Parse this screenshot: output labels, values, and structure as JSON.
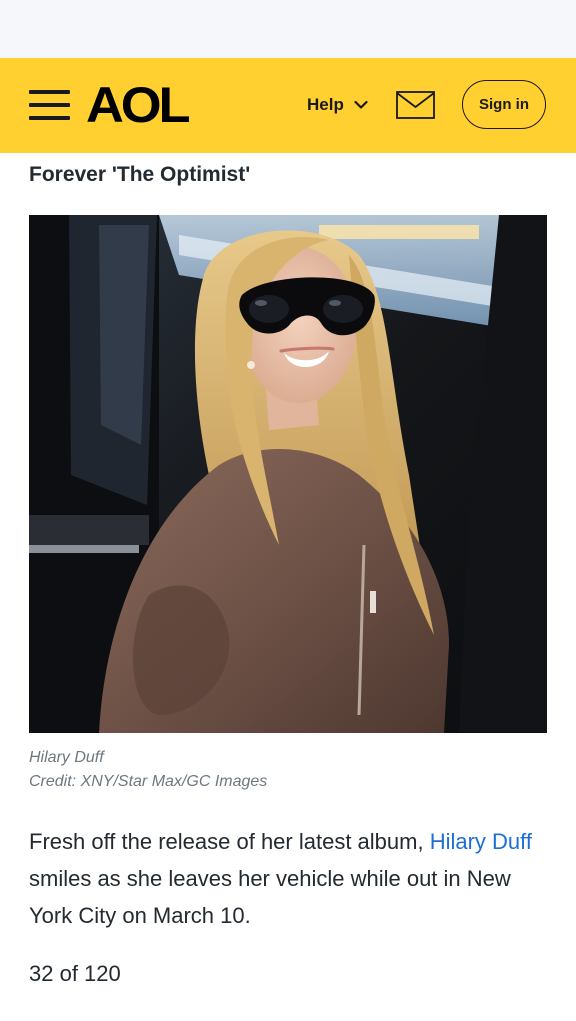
{
  "header": {
    "logo_text": "AOL",
    "help_label": "Help",
    "signin_label": "Sign in",
    "background_color": "#ffd02f"
  },
  "icons": {
    "menu": "hamburger-menu-icon",
    "help_dropdown": "chevron-down-icon",
    "mail": "envelope-icon"
  },
  "slide": {
    "title": "Forever 'The Optimist'",
    "photo_alt": "Hilary Duff",
    "caption_name": "Hilary Duff",
    "caption_credit": "Credit: XNY/Star Max/GC Images",
    "body_before": "Fresh off the release of her latest album, ",
    "body_link": "Hilary Duff",
    "body_after": " smiles as she leaves her vehicle while out in New York City on March 10.",
    "counter": "32 of 120",
    "link_color": "#1d6fd6"
  }
}
